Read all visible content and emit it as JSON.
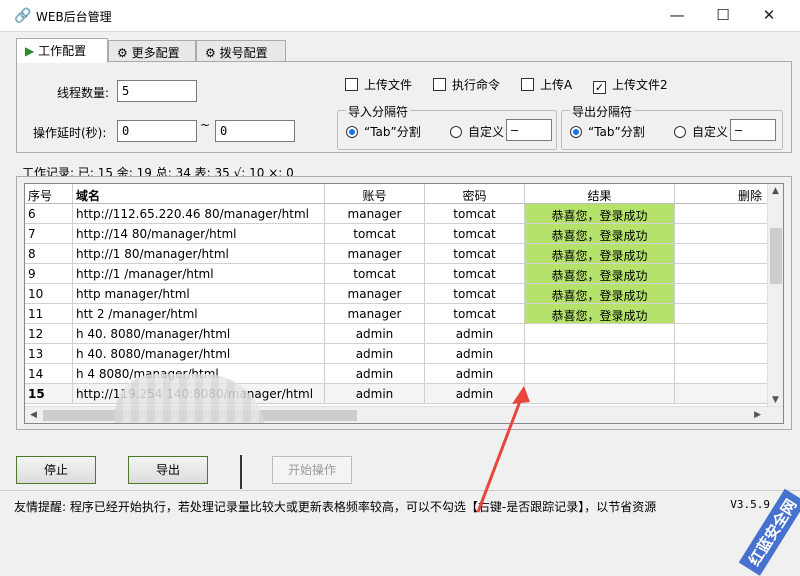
{
  "window": {
    "title": "WEB后台管理",
    "minimize_glyph": "—",
    "maximize_glyph": "☐",
    "close_glyph": "✕"
  },
  "tabs": [
    {
      "label": "工作配置",
      "icon": "play-icon"
    },
    {
      "label": "更多配置",
      "icon": "gear-icon"
    },
    {
      "label": "拨号配置",
      "icon": "gear-icon"
    }
  ],
  "config": {
    "threads_label": "线程数量:",
    "threads_value": "5",
    "delay_label": "操作延时(秒):",
    "delay_min": "0",
    "delay_sep": "~",
    "delay_max": "0",
    "checkboxes": [
      {
        "label": "上传文件",
        "checked": false
      },
      {
        "label": "执行命令",
        "checked": false
      },
      {
        "label": "上传A",
        "checked": false
      },
      {
        "label": "上传文件2",
        "checked": true
      }
    ],
    "import_sep": {
      "title": "导入分隔符",
      "tab_option": "“Tab”分割",
      "custom_option": "自定义",
      "custom_value": "—",
      "selected": "tab"
    },
    "export_sep": {
      "title": "导出分隔符",
      "tab_option": "“Tab”分割",
      "custom_option": "自定义",
      "custom_value": "—",
      "selected": "tab"
    }
  },
  "stats": {
    "text": "工作记录:  已: 15 余: 19 总: 34 表: 35 √: 10 ×: 0"
  },
  "table": {
    "columns": [
      "序号",
      "域名",
      "账号",
      "密码",
      "结果",
      "删除"
    ],
    "rows": [
      {
        "no": "6",
        "domain": "http://112.65.220.46 80/manager/html",
        "user": "manager",
        "pass": "tomcat",
        "result": "恭喜您，登录成功"
      },
      {
        "no": "7",
        "domain": "http://14         80/manager/html",
        "user": "tomcat",
        "pass": "tomcat",
        "result": "恭喜您，登录成功"
      },
      {
        "no": "8",
        "domain": "http://1          80/manager/html",
        "user": "manager",
        "pass": "tomcat",
        "result": "恭喜您，登录成功"
      },
      {
        "no": "9",
        "domain": "http://1          /manager/html",
        "user": "tomcat",
        "pass": "tomcat",
        "result": "恭喜您，登录成功"
      },
      {
        "no": "10",
        "domain": "http          manager/html",
        "user": "manager",
        "pass": "tomcat",
        "result": "恭喜您，登录成功"
      },
      {
        "no": "11",
        "domain": "htt    2        /manager/html",
        "user": "manager",
        "pass": "tomcat",
        "result": "恭喜您，登录成功"
      },
      {
        "no": "12",
        "domain": "h    40.      8080/manager/html",
        "user": "admin",
        "pass": "admin",
        "result": ""
      },
      {
        "no": "13",
        "domain": "h    40.      8080/manager/html",
        "user": "admin",
        "pass": "admin",
        "result": ""
      },
      {
        "no": "14",
        "domain": "h    4        8080/manager/html",
        "user": "admin",
        "pass": "admin",
        "result": ""
      },
      {
        "no": "15",
        "domain": "http://119.254  140:8080/manager/html",
        "user": "admin",
        "pass": "admin",
        "result": ""
      }
    ]
  },
  "buttons": {
    "stop": "停止",
    "export": "导出",
    "start": "开始操作"
  },
  "status": {
    "text": "友情提醒:  程序已经开始执行，若处理记录量比较大或更新表格频率较高，可以不勾选【右键-是否跟踪记录】，以节省资源",
    "version": "V3.5.9"
  },
  "watermark": "红蓝安全网",
  "colors": {
    "success_bg": "#b5e26a",
    "arrow": "#e8463c",
    "check_accent": "#1a73e8"
  }
}
